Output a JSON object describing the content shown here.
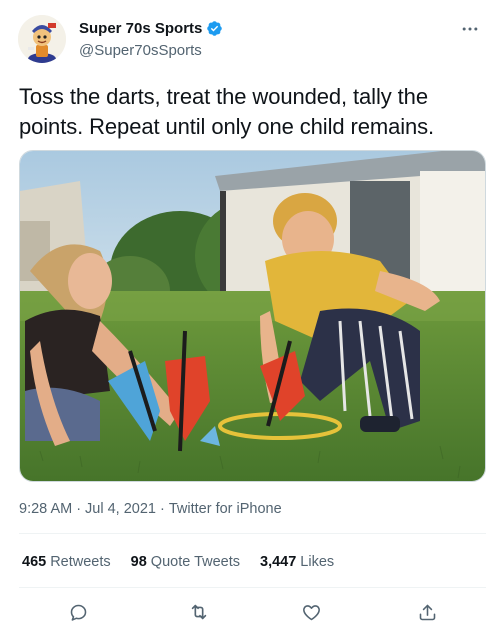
{
  "author": {
    "display_name": "Super 70s Sports",
    "handle": "@Super70sSports",
    "verified": true
  },
  "tweet": {
    "text": "Toss the darts, treat the wounded, tally the points. Repeat until only one child remains.",
    "time": "9:28 AM",
    "separator1": "·",
    "date": "Jul 4, 2021",
    "separator2": "·",
    "source": "Twitter for iPhone"
  },
  "stats": {
    "retweets_count": "465",
    "retweets_label": "Retweets",
    "quote_count": "98",
    "quote_label": "Quote Tweets",
    "likes_count": "3,447",
    "likes_label": "Likes"
  },
  "icons": {
    "more": "more-icon",
    "reply": "reply-icon",
    "retweet": "retweet-icon",
    "like": "heart-icon",
    "share": "share-icon",
    "verified": "verified-badge-icon"
  },
  "colors": {
    "text_primary": "#0f1419",
    "text_secondary": "#536471",
    "verified_blue": "#1d9bf0",
    "divider": "#eff3f4"
  }
}
